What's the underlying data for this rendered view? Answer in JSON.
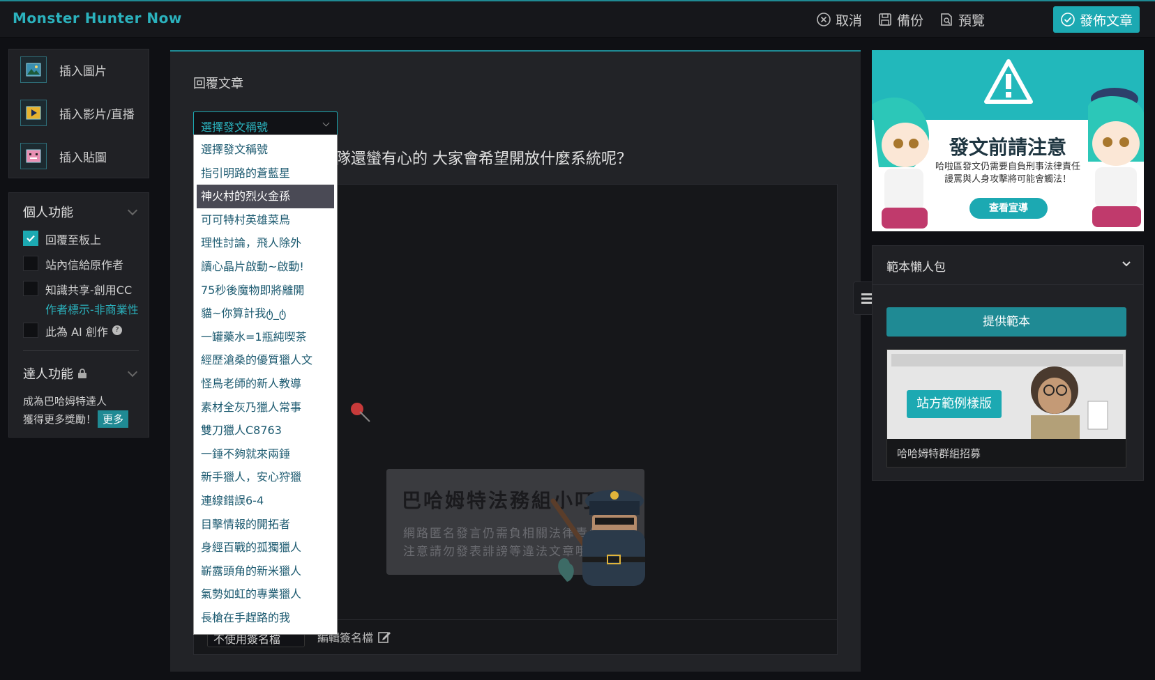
{
  "topbar": {
    "brand": "Monster Hunter Now",
    "cancel_label": "取消",
    "backup_label": "備份",
    "preview_label": "預覽",
    "publish_label": "發佈文章"
  },
  "insert_panel": {
    "items": [
      {
        "label": "插入圖片",
        "icon": "image-icon"
      },
      {
        "label": "插入影片/直播",
        "icon": "video-icon"
      },
      {
        "label": "插入貼圖",
        "icon": "sticker-icon"
      }
    ]
  },
  "personal": {
    "title": "個人功能",
    "options": [
      {
        "label": "回覆至板上",
        "checked": true
      },
      {
        "label": "站內信給原作者",
        "checked": false
      },
      {
        "label": "知識共享-創用CC",
        "sub": "作者標示-非商業性",
        "checked": false
      },
      {
        "label": "此為 AI 創作",
        "checked": false
      }
    ],
    "expert_title": "達人功能",
    "expert_text_1": "成為巴哈姆特達人",
    "expert_text_2": "獲得更多獎勵！",
    "more_label": "更多"
  },
  "main": {
    "reply_title": "回覆文章",
    "title_select": "選擇發文稱號",
    "subject_partial": "隊還蠻有心的 大家會希望開放什麼系統呢？",
    "signature_select": "不使用簽名檔",
    "edit_signature": "編輯簽名檔",
    "legal_title": "巴哈姆特法務組小叮嚀",
    "legal_line1": "網路匿名發言仍需負相關法律責任",
    "legal_line2": "注意請勿發表誹謗等違法文章哦！"
  },
  "dropdown": {
    "highlighted_index": 2,
    "options": [
      "選擇發文稱號",
      "指引明路的蒼藍星",
      "神火村的烈火金孫",
      "可可特村英雄菜鳥",
      "理性討論，飛人除外",
      "讀心晶片啟動~啟動!",
      "75秒後魔物即將離開",
      "貓~你算計我ტ_ტ",
      "一罐藥水=1瓶純喫茶",
      "經歷滄桑的優質獵人文",
      "怪鳥老師的新人教導",
      "素材全灰乃獵人常事",
      "雙刀獵人C8763",
      "一錘不夠就來兩錘",
      "新手獵人，安心狩獵",
      "連線錯誤6-4",
      "目擊情報的開拓者",
      "身經百戰的孤獨獵人",
      "嶄露頭角的新米獵人",
      "氣勢如虹的專業獵人",
      "長槍在手趕路的我"
    ]
  },
  "notice_ad": {
    "title": "發文前請注意",
    "line1": "哈啦區發文仍需要自負刑事法律責任",
    "line2": "謾罵與人身攻擊將可能會觸法！",
    "button": "查看宣導"
  },
  "template_pack": {
    "title": "範本懶人包",
    "provide_button": "提供範本",
    "badge": "站方範例樣版",
    "caption": "哈哈姆特群組招募"
  },
  "colors": {
    "accent": "#1ca9b2",
    "background": "#0f1014",
    "panel": "#202125"
  }
}
